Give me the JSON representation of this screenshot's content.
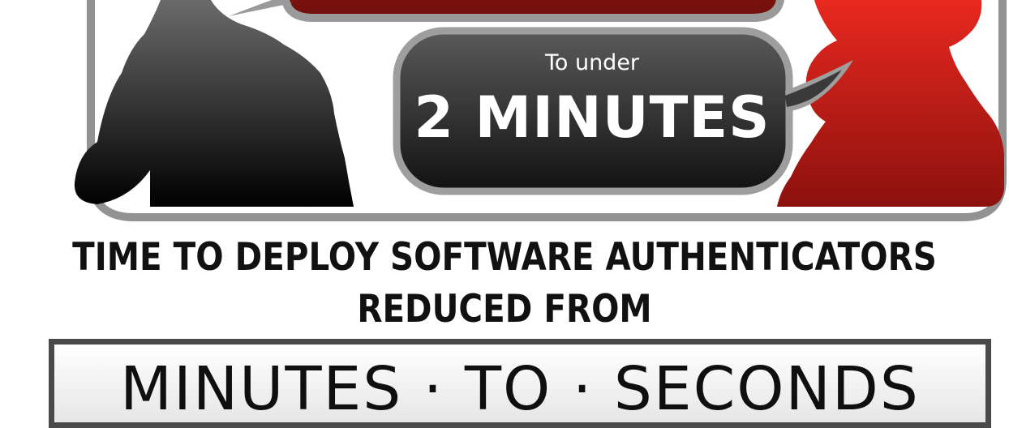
{
  "bubble": {
    "prefix": "To under",
    "value": "2 MINUTES"
  },
  "headline": {
    "line1": "TIME TO DEPLOY SOFTWARE AUTHENTICATORS",
    "line2": "REDUCED FROM"
  },
  "banner": {
    "text": "MINUTES · TO · SECONDS"
  },
  "colors": {
    "dark_bubble": "#2b2b2b",
    "red_accent": "#d41f1a",
    "frame_gray": "#8f8f8f",
    "banner_border": "#4a4a4a"
  }
}
